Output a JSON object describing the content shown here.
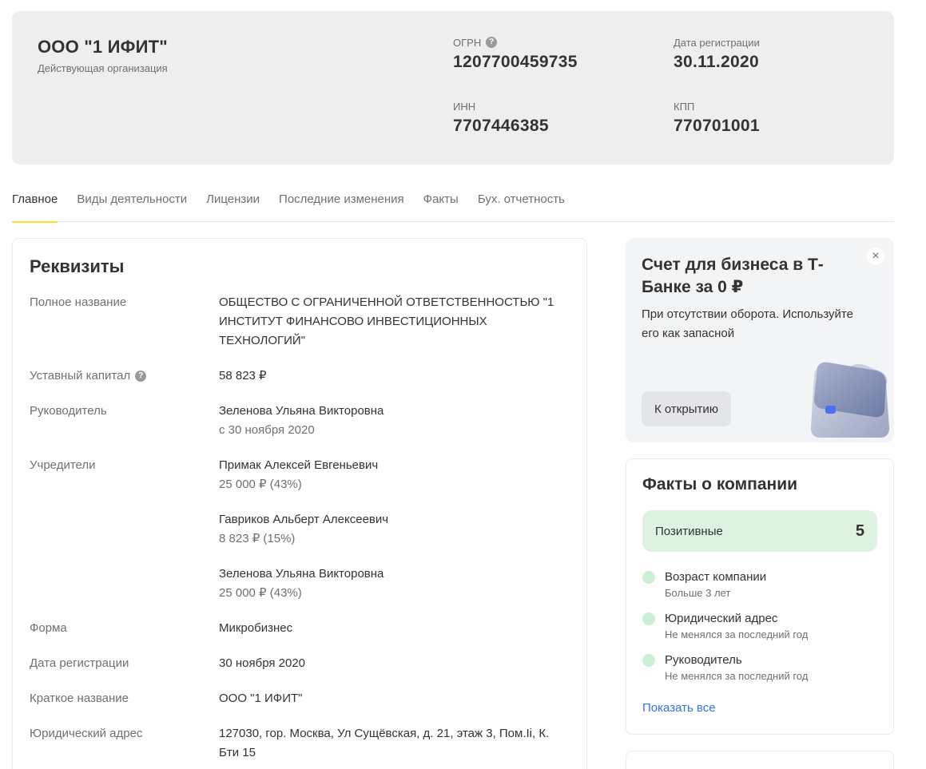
{
  "header": {
    "company_name": "ООО \"1 ИФИТ\"",
    "status": "Действующая организация",
    "ogrn": {
      "label": "ОГРН",
      "value": "1207700459735"
    },
    "reg_date": {
      "label": "Дата регистрации",
      "value": "30.11.2020"
    },
    "inn": {
      "label": "ИНН",
      "value": "7707446385"
    },
    "kpp": {
      "label": "КПП",
      "value": "770701001"
    }
  },
  "tabs": [
    {
      "label": "Главное"
    },
    {
      "label": "Виды деятельности"
    },
    {
      "label": "Лицензии"
    },
    {
      "label": "Последние изменения"
    },
    {
      "label": "Факты"
    },
    {
      "label": "Бух. отчетность"
    }
  ],
  "requisites": {
    "title": "Реквизиты",
    "full_name": {
      "label": "Полное название",
      "value": "ОБЩЕСТВО С ОГРАНИЧЕННОЙ ОТВЕТСТВЕННОСТЬЮ \"1 ИНСТИТУТ ФИНАНСОВО ИНВЕСТИЦИОННЫХ ТЕХНОЛОГИЙ\""
    },
    "capital": {
      "label": "Уставный капитал",
      "value": "58 823 ₽"
    },
    "director": {
      "label": "Руководитель",
      "name": "Зеленова Ульяна Викторовна",
      "since": "с 30 ноября 2020"
    },
    "founders": {
      "label": "Учредители",
      "items": [
        {
          "name": "Примак Алексей Евгеньевич",
          "share": "25 000 ₽ (43%)"
        },
        {
          "name": "Гавриков Альберт Алексеевич",
          "share": "8 823 ₽ (15%)"
        },
        {
          "name": "Зеленова Ульяна Викторовна",
          "share": "25 000 ₽ (43%)"
        }
      ]
    },
    "form": {
      "label": "Форма",
      "value": "Микробизнес"
    },
    "reg_date": {
      "label": "Дата регистрации",
      "value": "30 ноября 2020"
    },
    "short_name": {
      "label": "Краткое название",
      "value": "ООО \"1 ИФИТ\""
    },
    "address": {
      "label": "Юридический адрес",
      "value": "127030, гор. Москва, Ул Сущёвская, д. 21, этаж 3, Пом.Ii, К. Бти 15"
    }
  },
  "promo": {
    "title": "Счет для бизнеса в Т-Банке за 0 ₽",
    "text": "При отсутствии оборота. Используйте его как запасной",
    "button": "К открытию",
    "close": "×"
  },
  "facts": {
    "title": "Факты о компании",
    "positive_label": "Позитивные",
    "positive_count": "5",
    "items": [
      {
        "title": "Возраст компании",
        "sub": "Больше 3 лет"
      },
      {
        "title": "Юридический адрес",
        "sub": "Не менялся за последний год"
      },
      {
        "title": "Руководитель",
        "sub": "Не менялся за последний год"
      }
    ],
    "show_all": "Показать все"
  },
  "icons": {
    "help": "help-icon",
    "close": "close-icon",
    "briefcase": "briefcase-icon"
  },
  "colors": {
    "accent": "#ffdd2d",
    "link": "#336fee",
    "positive": "#ddf2e0"
  }
}
